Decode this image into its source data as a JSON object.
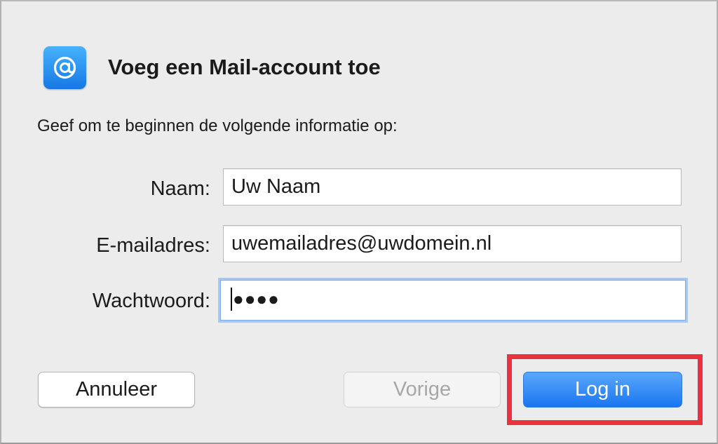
{
  "dialog": {
    "title": "Voeg een Mail-account toe",
    "intro": "Geef om te beginnen de volgende informatie op:",
    "app_icon": "mail-at-icon"
  },
  "form": {
    "name_label": "Naam:",
    "name_value": "Uw Naam",
    "email_label": "E-mailadres:",
    "email_value": "uwemailadres@uwdomein.nl",
    "password_label": "Wachtwoord:",
    "password_mask": "●●●●"
  },
  "buttons": {
    "cancel": "Annuleer",
    "previous": "Vorige",
    "login": "Log in"
  },
  "colors": {
    "accent": "#1a76f0",
    "highlight": "#e8323f",
    "focus_ring": "#a9c8f0"
  }
}
